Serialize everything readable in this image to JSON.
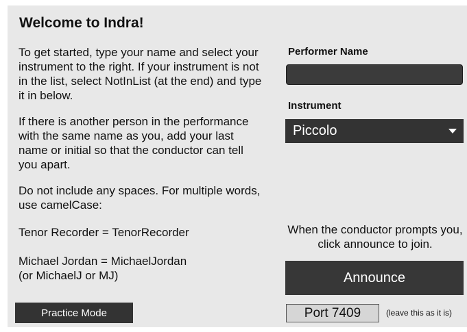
{
  "header": {
    "title": "Welcome to Indra!"
  },
  "instructions": {
    "p1": "To get started, type your name and select your instrument to the right. If your instrument is not in the list, select NotInList (at the end) and type it in below.",
    "p2": "If there is another person in the performance with the same name as you, add your last name or initial so that the conductor can tell you apart.",
    "p3": "Do not include any spaces. For multiple words, use camelCase:",
    "p4": "Tenor Recorder = TenorRecorder",
    "p5_line1": "Michael Jordan = MichaelJordan",
    "p5_line2": "(or MichaelJ or MJ)"
  },
  "form": {
    "performer_name_label": "Performer Name",
    "performer_name_value": "",
    "instrument_label": "Instrument",
    "instrument_selected": "Piccolo"
  },
  "announce": {
    "prompt": "When the conductor prompts you, click announce to join.",
    "button_label": "Announce"
  },
  "footer": {
    "practice_button_label": "Practice Mode",
    "port_value": "Port 7409",
    "port_hint": "(leave this as it is)"
  },
  "icons": {
    "instrument_dropdown": "caret-down-icon"
  },
  "colors": {
    "panel_background": "#e8e8e8",
    "dark_control": "#333333",
    "control_text": "#ffffff"
  }
}
